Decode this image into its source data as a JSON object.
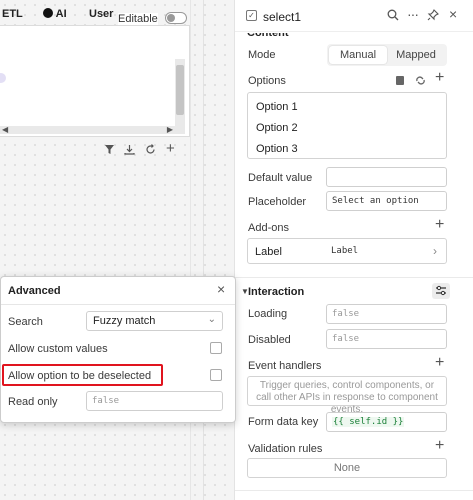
{
  "canvas": {
    "tabs": [
      "ETL",
      "AI",
      "User"
    ],
    "editable_label": "Editable",
    "table_toolbar_icons": [
      "filter-icon",
      "download-icon",
      "refresh-icon",
      "add-icon"
    ]
  },
  "inspector": {
    "component_name": "select1",
    "section_content_label": "Content",
    "mode": {
      "label": "Mode",
      "options": [
        "Manual",
        "Mapped"
      ],
      "selected": "Manual"
    },
    "options": {
      "label": "Options",
      "items": [
        "Option 1",
        "Option 2",
        "Option 3"
      ]
    },
    "default_value": {
      "label": "Default value",
      "value": ""
    },
    "placeholder": {
      "label": "Placeholder",
      "value": "Select an option"
    },
    "addons": {
      "label": "Add-ons",
      "row_label": "Label",
      "row_value": "Label"
    },
    "interaction": {
      "title": "Interaction"
    },
    "loading": {
      "label": "Loading",
      "placeholder": "false"
    },
    "disabled": {
      "label": "Disabled",
      "placeholder": "false"
    },
    "event_handlers": {
      "label": "Event handlers",
      "hint": "Trigger queries, control components, or call other APIs in response to component events."
    },
    "form_data_key": {
      "label": "Form data key",
      "value": "{{ self.id }}"
    },
    "validation_rules": {
      "label": "Validation rules",
      "value": "None"
    }
  },
  "advanced": {
    "title": "Advanced",
    "search": {
      "label": "Search",
      "value": "Fuzzy match"
    },
    "allow_custom_values": {
      "label": "Allow custom values",
      "checked": false
    },
    "allow_deselect": {
      "label": "Allow option to be deselected",
      "checked": false
    },
    "read_only": {
      "label": "Read only",
      "placeholder": "false"
    }
  },
  "colors": {
    "highlight": "#e0141e",
    "form_key_text": "#1a7f37",
    "form_key_bg": "#eef8f0"
  }
}
